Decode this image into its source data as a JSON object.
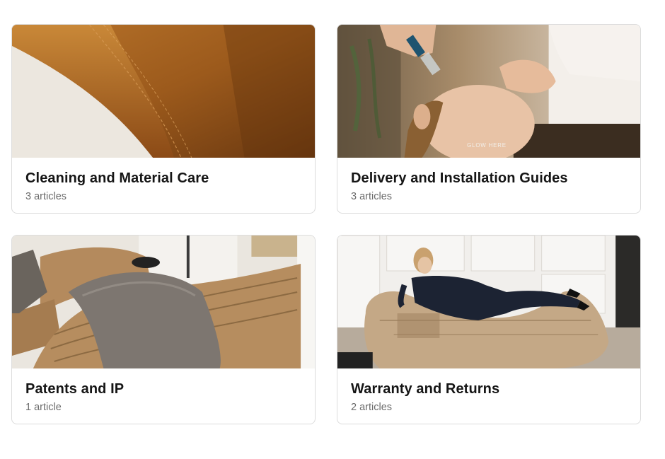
{
  "cards": [
    {
      "title": "Cleaning and Material Care",
      "count": "3 articles",
      "image": "leather-seam-closeup"
    },
    {
      "title": "Delivery and Installation Guides",
      "count": "3 articles",
      "image": "facial-treatment",
      "image_overlay_text": "GLOW HERE"
    },
    {
      "title": "Patents and IP",
      "count": "1 article",
      "image": "ribbed-leather-loungers-with-throw"
    },
    {
      "title": "Warranty and Returns",
      "count": "2 articles",
      "image": "woman-reclining-on-lounger"
    }
  ]
}
